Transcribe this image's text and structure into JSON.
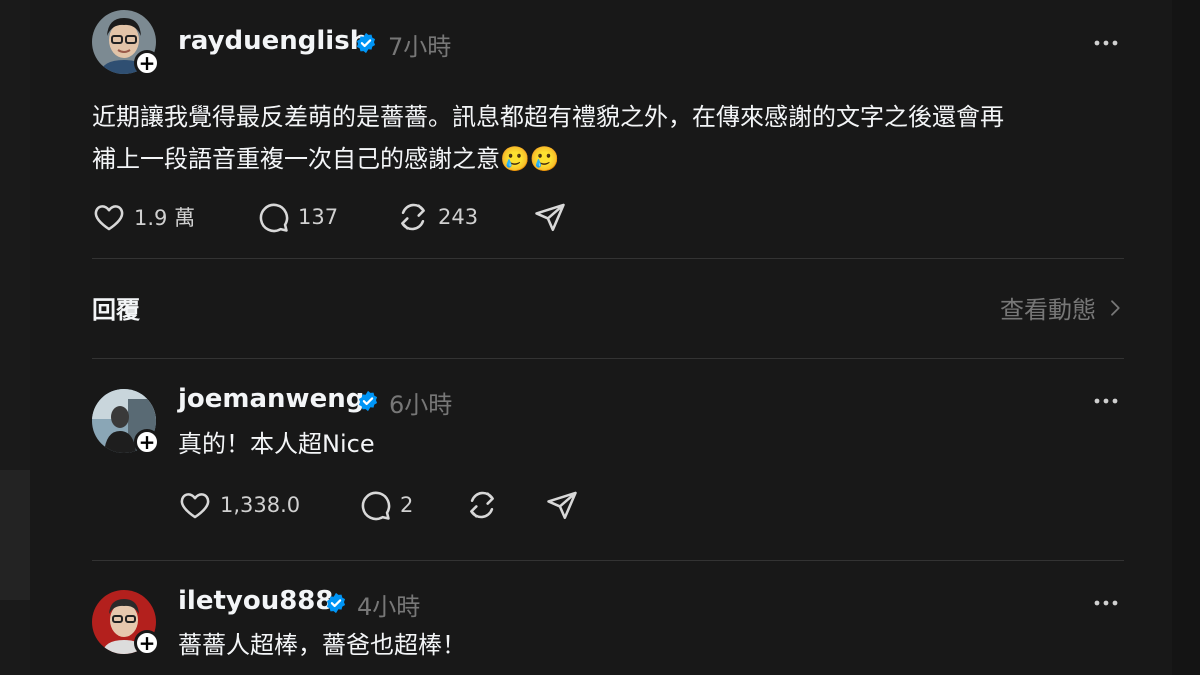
{
  "main_post": {
    "username": "rayduenglish",
    "time": "7小時",
    "text_line1": "近期讓我覺得最反差萌的是薔薔。訊息都超有禮貌之外，在傳來感謝的文字之後還會再",
    "text_line2": "補上一段語音重複一次自己的感謝之意🥲🥲",
    "likes": "1.9 萬",
    "comments": "137",
    "reposts": "243"
  },
  "replies_header": {
    "title": "回覆",
    "view_activity": "查看動態"
  },
  "replies": [
    {
      "username": "joemanweng",
      "time": "6小時",
      "text": "真的！本人超Nice",
      "likes": "1,338.0",
      "comments": "2"
    },
    {
      "username": "iletyou888",
      "time": "4小時",
      "text": "薔薔人超棒，薔爸也超棒！"
    }
  ],
  "colors": {
    "background": "#181818",
    "verified": "#0095f6",
    "muted": "#777777"
  }
}
